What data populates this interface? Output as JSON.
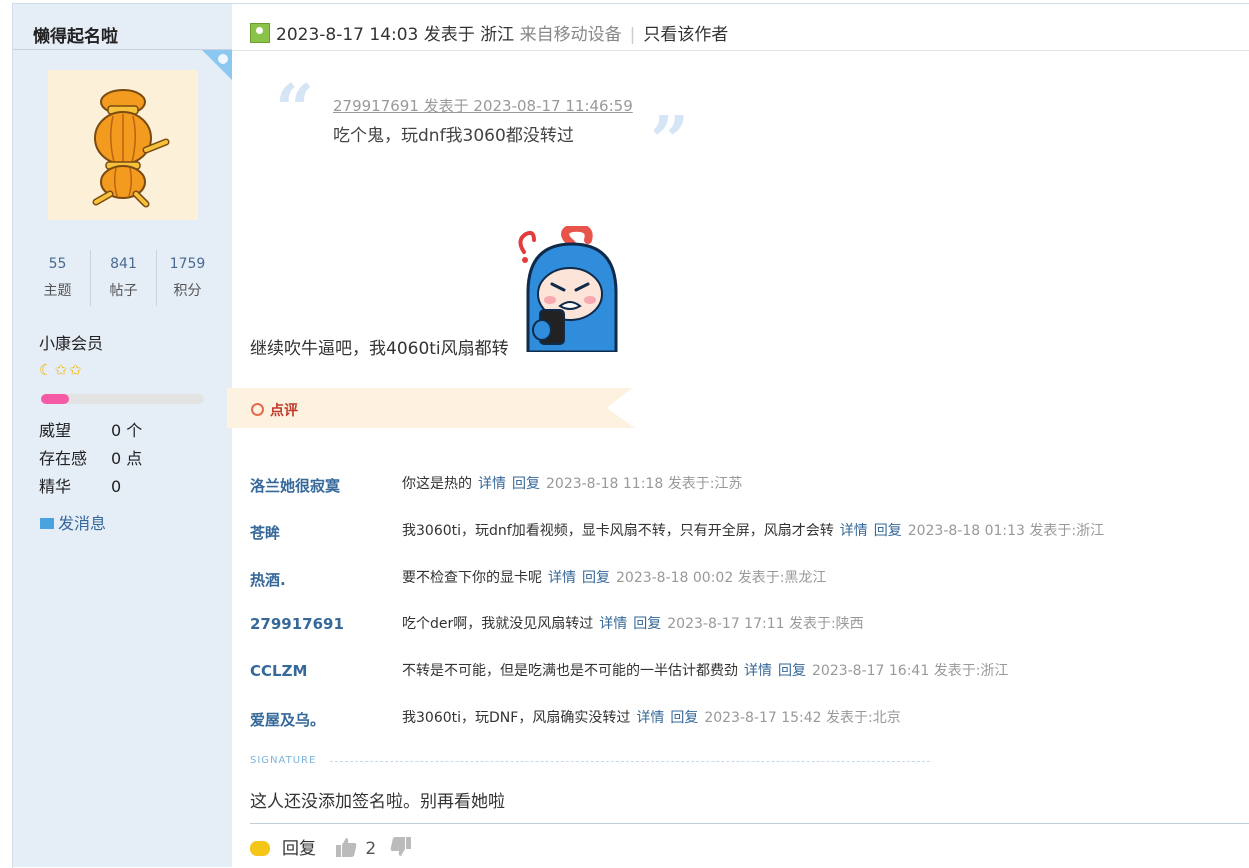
{
  "author": {
    "name": "懒得起名啦",
    "stats": [
      {
        "value": "55",
        "label": "主题"
      },
      {
        "value": "841",
        "label": "帖子"
      },
      {
        "value": "1759",
        "label": "积分"
      }
    ],
    "rank": "小康会员",
    "stars": "☾✩✩",
    "level_progress": 0.17,
    "info": [
      {
        "key": "威望",
        "value": "0 个"
      },
      {
        "key": "存在感",
        "value": "0 点"
      },
      {
        "key": "精华",
        "value": "0"
      }
    ],
    "message_label": "发消息"
  },
  "post": {
    "header": {
      "time": "2023-8-17 14:03 发表于 浙江",
      "source": "来自移动设备",
      "separator": "|",
      "only_author": "只看该作者"
    },
    "quote": {
      "meta": "279917691 发表于 2023-08-17 11:46:59",
      "text": "吃个鬼，玩dnf我3060都没转过"
    },
    "body": "继续吹牛逼吧，我4060ti风扇都转"
  },
  "review": {
    "label": "点评",
    "comments": [
      {
        "user": "洛兰她很寂寞",
        "text": "你这是热的",
        "detail": "详情",
        "reply": "回复",
        "meta": "2023-8-18 11:18 发表于:江苏"
      },
      {
        "user": "苍眸",
        "text": "我3060ti，玩dnf加看视频，显卡风扇不转，只有开全屏，风扇才会转",
        "detail": "详情",
        "reply": "回复",
        "meta": "2023-8-18 01:13 发表于:浙江"
      },
      {
        "user": "热酒.",
        "text": "要不检查下你的显卡呢",
        "detail": "详情",
        "reply": "回复",
        "meta": "2023-8-18 00:02 发表于:黑龙江"
      },
      {
        "user": "279917691",
        "text": "吃个der啊，我就没见风扇转过",
        "detail": "详情",
        "reply": "回复",
        "meta": "2023-8-17 17:11 发表于:陕西"
      },
      {
        "user": "CCLZM",
        "text": "不转是不可能，但是吃满也是不可能的一半估计都费劲",
        "detail": "详情",
        "reply": "回复",
        "meta": "2023-8-17 16:41 发表于:浙江"
      },
      {
        "user": "爱屋及乌。",
        "text": "我3060ti，玩DNF，风扇确实没转过",
        "detail": "详情",
        "reply": "回复",
        "meta": "2023-8-17 15:42 发表于:北京"
      }
    ]
  },
  "signature": {
    "label": "SIGNATURE",
    "text": "这人还没添加签名啦。别再看她啦"
  },
  "footer": {
    "reply_label": "回复",
    "like_count": "2"
  },
  "colors": {
    "sidebar_bg": "#e5edf7",
    "link": "#36689a",
    "banner_bg": "#fdf2e0",
    "review_label": "#c0392b"
  }
}
